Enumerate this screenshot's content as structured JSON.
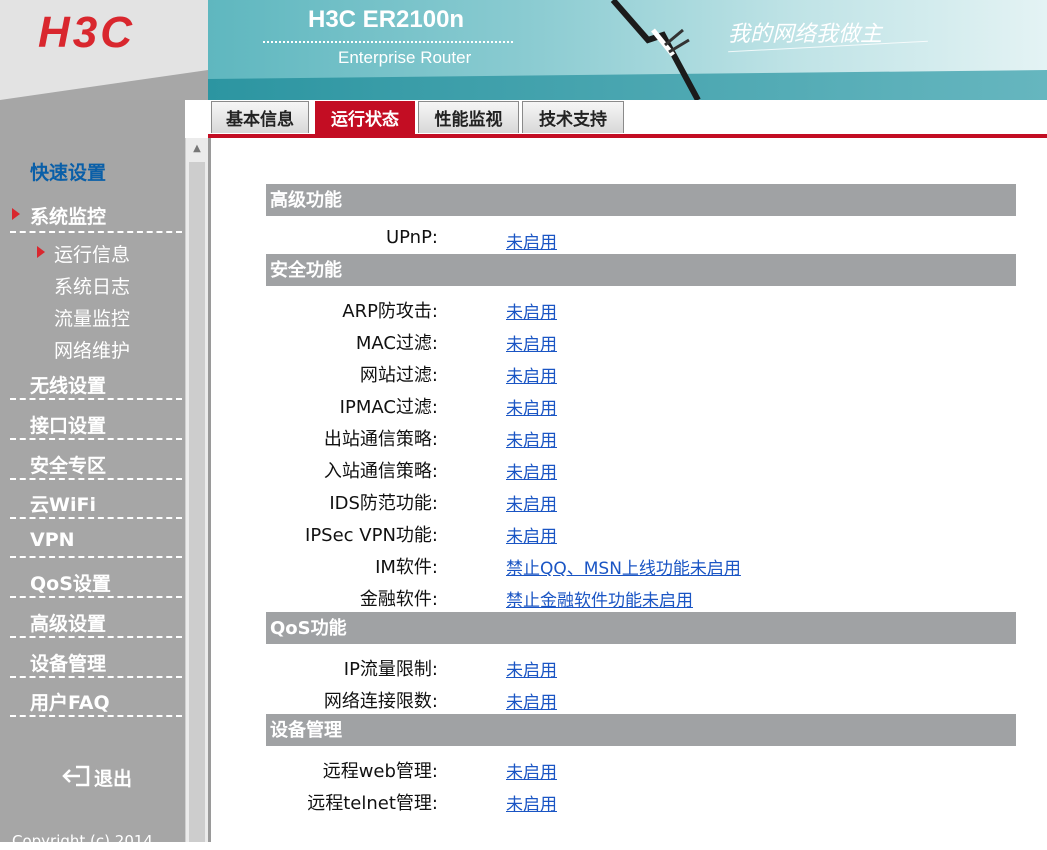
{
  "header": {
    "logo": "H3C",
    "product_name": "H3C ER2100n",
    "product_sub": "Enterprise Router",
    "slogan": "我的网络我做主"
  },
  "tabs": [
    {
      "label": "基本信息",
      "active": false
    },
    {
      "label": "运行状态",
      "active": true
    },
    {
      "label": "性能监视",
      "active": false
    },
    {
      "label": "技术支持",
      "active": false
    }
  ],
  "sidebar": {
    "quick_setup": "快速设置",
    "groups": [
      {
        "label": "系统监控",
        "expanded": true,
        "items": [
          "运行信息",
          "系统日志",
          "流量监控",
          "网络维护"
        ],
        "selected": "运行信息"
      },
      {
        "label": "无线设置"
      },
      {
        "label": "接口设置"
      },
      {
        "label": "安全专区"
      },
      {
        "label": "云WiFi"
      },
      {
        "label": "VPN"
      },
      {
        "label": "QoS设置"
      },
      {
        "label": "高级设置"
      },
      {
        "label": "设备管理"
      },
      {
        "label": "用户FAQ"
      }
    ],
    "logout": "退出",
    "copyright": "Copyright (c) 2014"
  },
  "sections": [
    {
      "title": "高级功能",
      "rows": [
        {
          "label": "UPnP:",
          "value": "未启用"
        }
      ]
    },
    {
      "title": "安全功能",
      "rows": [
        {
          "label": "ARP防攻击:",
          "value": "未启用"
        },
        {
          "label": "MAC过滤:",
          "value": "未启用"
        },
        {
          "label": "网站过滤:",
          "value": "未启用"
        },
        {
          "label": "IPMAC过滤:",
          "value": "未启用"
        },
        {
          "label": "出站通信策略:",
          "value": "未启用"
        },
        {
          "label": "入站通信策略:",
          "value": "未启用"
        },
        {
          "label": "IDS防范功能:",
          "value": "未启用"
        },
        {
          "label": "IPSec VPN功能:",
          "value": "未启用"
        },
        {
          "label": "IM软件:",
          "value": "禁止QQ、MSN上线功能未启用"
        },
        {
          "label": "金融软件:",
          "value": "禁止金融软件功能未启用"
        }
      ]
    },
    {
      "title": "QoS功能",
      "rows": [
        {
          "label": "IP流量限制:",
          "value": "未启用"
        },
        {
          "label": "网络连接限数:",
          "value": "未启用"
        }
      ]
    },
    {
      "title": "设备管理",
      "rows": [
        {
          "label": "远程web管理:",
          "value": "未启用"
        },
        {
          "label": "远程telnet管理:",
          "value": "未启用"
        }
      ]
    }
  ],
  "colors": {
    "brand_red": "#c30d23",
    "link_blue": "#1a55c4",
    "sidebar_gray": "#a6a6a6"
  }
}
